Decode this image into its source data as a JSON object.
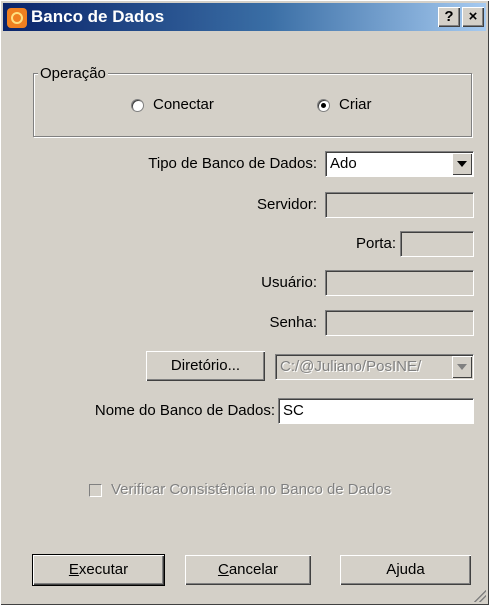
{
  "window": {
    "title": "Banco de Dados",
    "help_button": "?",
    "close_button": "×"
  },
  "operation": {
    "label": "Operação",
    "options": [
      {
        "label": "Conectar",
        "checked": false
      },
      {
        "label": "Criar",
        "checked": true
      }
    ]
  },
  "db_type": {
    "label": "Tipo de Banco de Dados:",
    "value": "Ado"
  },
  "server": {
    "label": "Servidor:",
    "value": ""
  },
  "port": {
    "label": "Porta:",
    "value": ""
  },
  "user": {
    "label": "Usuário:",
    "value": ""
  },
  "password": {
    "label": "Senha:",
    "value": ""
  },
  "directory": {
    "button_label": "Diretório...",
    "value": "C:/@Juliano/PosINE/"
  },
  "db_name": {
    "label": "Nome do Banco de Dados:",
    "value": "SC"
  },
  "verify": {
    "label": "Verificar Consistência no Banco de Dados",
    "checked": false
  },
  "buttons": {
    "execute": {
      "label": "Executar",
      "accel": "E",
      "rest": "xecutar"
    },
    "cancel": {
      "label": "Cancelar",
      "accel": "C",
      "rest": "ancelar"
    },
    "help": {
      "label": "Ajuda",
      "pre": "A",
      "accel": "j",
      "rest": "uda"
    }
  },
  "colors": {
    "face": "#d4d0c8",
    "title_start": "#0a246a",
    "title_end": "#a6caf0"
  }
}
